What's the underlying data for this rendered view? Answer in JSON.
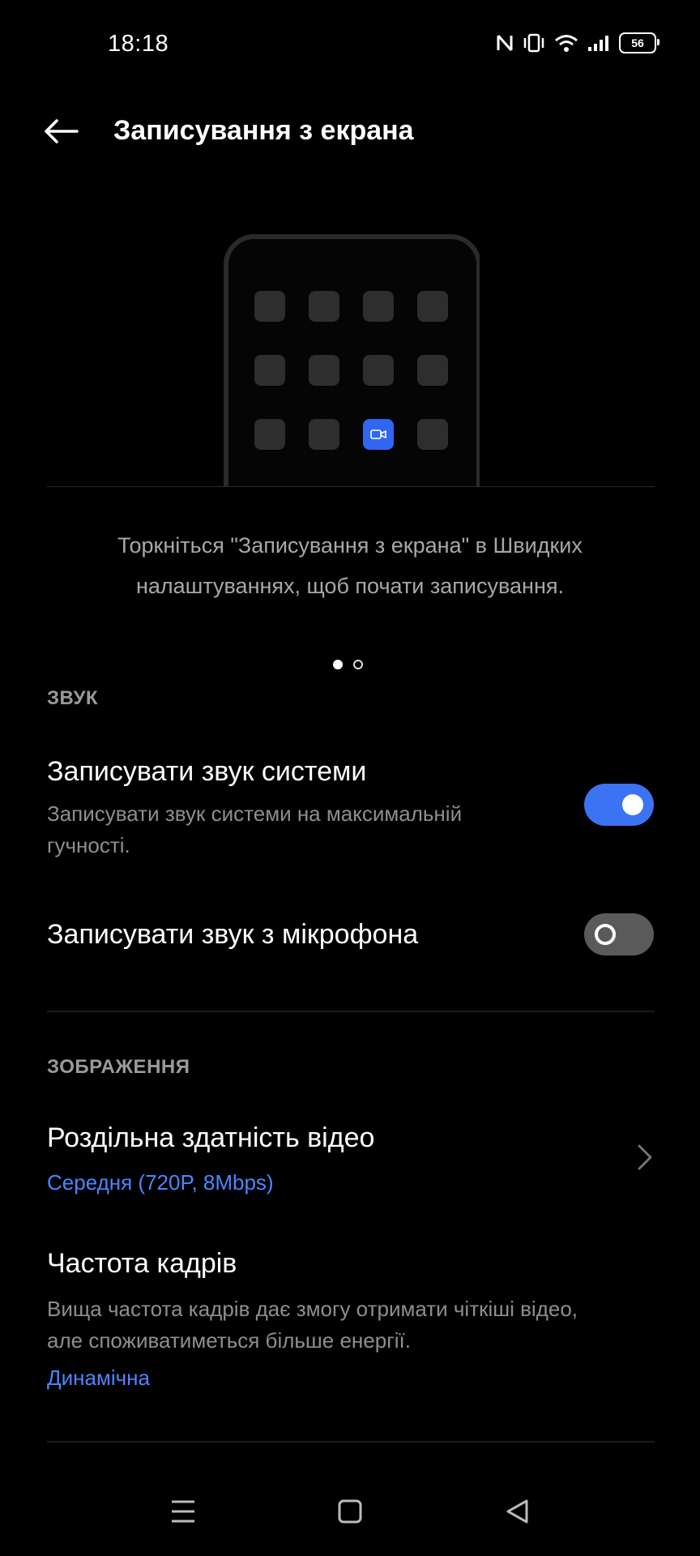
{
  "status_bar": {
    "time": "18:18",
    "battery": "56",
    "icons": [
      "nfc-icon",
      "vibrate-icon",
      "wifi-icon",
      "signal-icon",
      "battery-icon"
    ]
  },
  "header": {
    "title": "Записування з екрана",
    "back_icon": "arrow-left-icon"
  },
  "illustration": {
    "highlight_color": "#2f66f2"
  },
  "caption": {
    "line1": "Торкніться \"Записування з екрана\" в Швидких",
    "line2": "налаштуваннях, щоб почати записування."
  },
  "pager": {
    "count": 2,
    "active": 1
  },
  "sound_section": {
    "header": "ЗВУК",
    "system_sound": {
      "title": "Записувати звук системи",
      "subtitle_line1": "Записувати звук системи на максимальній",
      "subtitle_line2": "гучності.",
      "enabled": true
    },
    "mic_sound": {
      "title": "Записувати звук з мікрофона",
      "enabled": false
    }
  },
  "image_section": {
    "header": "ЗОБРАЖЕННЯ",
    "resolution": {
      "title": "Роздільна здатність відео",
      "value": "Середня (720P, 8Mbps)"
    },
    "frame_rate": {
      "title": "Частота кадрів",
      "subtitle_line1": "Вища частота кадрів дає змогу отримати чіткіші відео,",
      "subtitle_line2": "але споживатиметься більше енергії.",
      "value": "Динамічна"
    }
  },
  "colors": {
    "accent": "#3b73f3",
    "link": "#4a86ff",
    "background": "#000000"
  },
  "nav_bar": {
    "buttons": [
      "menu-icon",
      "home-icon",
      "back-triangle-icon"
    ]
  }
}
